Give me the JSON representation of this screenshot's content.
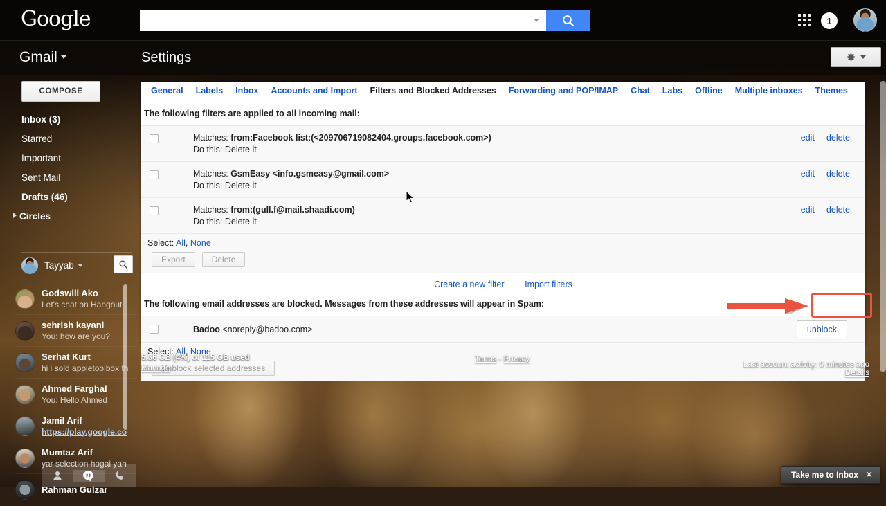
{
  "topbar": {
    "logo": "Google",
    "search_value": "",
    "search_placeholder": "",
    "search_icon": "search-icon",
    "apps_icon": "apps-grid-icon",
    "notification_count": "1",
    "avatar": "user-avatar"
  },
  "gmailbar": {
    "product": "Gmail",
    "page_title": "Settings",
    "gear_icon": "gear-icon"
  },
  "sidebar": {
    "compose_label": "COMPOSE",
    "items": [
      {
        "label": "Inbox (3)",
        "bold": true,
        "expandable": false
      },
      {
        "label": "Starred",
        "bold": false,
        "expandable": false
      },
      {
        "label": "Important",
        "bold": false,
        "expandable": false
      },
      {
        "label": "Sent Mail",
        "bold": false,
        "expandable": false
      },
      {
        "label": "Drafts (46)",
        "bold": true,
        "expandable": false
      },
      {
        "label": "Circles",
        "bold": true,
        "expandable": true
      }
    ],
    "hangouts_user": "Tayyab",
    "hangouts_search_icon": "search-icon",
    "contacts": [
      {
        "name": "Godswill Ako",
        "sub": "Let's chat on Hangout",
        "link": false
      },
      {
        "name": "sehrish kayani",
        "sub": "You: how are you?",
        "link": false
      },
      {
        "name": "Serhat Kurt",
        "sub": "hi i sold appletoolbox th",
        "link": false
      },
      {
        "name": "Ahmed Farghal",
        "sub": "You: Hello Ahmed",
        "link": false
      },
      {
        "name": "Jamil Arif",
        "sub": "https://play.google.co",
        "link": true
      },
      {
        "name": "Mumtaz Arif",
        "sub": "yar selection hogai yah",
        "link": false
      },
      {
        "name": "Rahman Gulzar",
        "sub": "",
        "link": false
      }
    ],
    "hangouts_tabs": [
      {
        "icon": "person-icon",
        "active": false
      },
      {
        "icon": "hangouts-quote-icon",
        "active": true
      },
      {
        "icon": "phone-icon",
        "active": false
      }
    ]
  },
  "settings": {
    "tabs": [
      {
        "label": "General",
        "active": false
      },
      {
        "label": "Labels",
        "active": false
      },
      {
        "label": "Inbox",
        "active": false
      },
      {
        "label": "Accounts and Import",
        "active": false
      },
      {
        "label": "Filters and Blocked Addresses",
        "active": true
      },
      {
        "label": "Forwarding and POP/IMAP",
        "active": false
      },
      {
        "label": "Chat",
        "active": false
      },
      {
        "label": "Labs",
        "active": false
      },
      {
        "label": "Offline",
        "active": false
      },
      {
        "label": "Multiple inboxes",
        "active": false
      },
      {
        "label": "Themes",
        "active": false
      }
    ],
    "filters_heading": "The following filters are applied to all incoming mail:",
    "filters": [
      {
        "matches_label": "Matches:",
        "matches_value": "from:Facebook list:(<209706719082404.groups.facebook.com>)",
        "action_label": "Do this:",
        "action_value": "Delete it",
        "edit": "edit",
        "delete": "delete",
        "checked": false
      },
      {
        "matches_label": "Matches:",
        "matches_value": "GsmEasy <info.gsmeasy@gmail.com>",
        "action_label": "Do this:",
        "action_value": "Delete it",
        "edit": "edit",
        "delete": "delete",
        "checked": false
      },
      {
        "matches_label": "Matches:",
        "matches_value": "from:(gull.f@mail.shaadi.com)",
        "action_label": "Do this:",
        "action_value": "Delete it",
        "edit": "edit",
        "delete": "delete",
        "checked": false
      }
    ],
    "select_label": "Select:",
    "select_all": "All",
    "select_sep": ",",
    "select_none": "None",
    "export_button": "Export",
    "delete_button": "Delete",
    "create_filter_link": "Create a new filter",
    "import_filters_link": "Import filters",
    "blocked_heading": "The following email addresses are blocked. Messages from these addresses will appear in Spam:",
    "blocked": [
      {
        "name": "Badoo",
        "address": "<noreply@badoo.com>",
        "unblock_label": "unblock",
        "checked": false,
        "highlighted": true
      }
    ],
    "unblock_selected_button": "Unblock selected addresses"
  },
  "footer": {
    "quota": "5.36 GB (4%) of 115 GB used",
    "manage": "Manage",
    "terms": "Terms",
    "separator": "-",
    "privacy": "Privacy",
    "last_activity": "Last account activity: 0 minutes ago",
    "details": "Details"
  },
  "toast": {
    "label": "Take me to Inbox",
    "close_icon": "close-icon",
    "close_glyph": "✕"
  },
  "annotation": {
    "arrow_color": "#e8543f",
    "box_color": "#e8543f",
    "target": "unblock-button"
  }
}
